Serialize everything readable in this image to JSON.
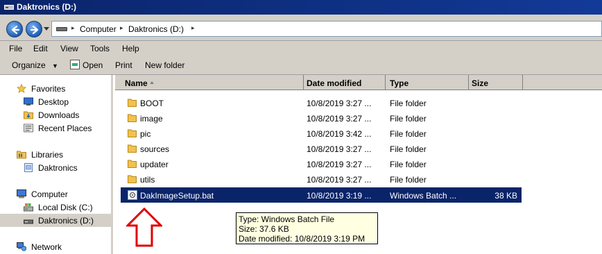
{
  "window": {
    "title": "Daktronics (D:)"
  },
  "address": {
    "crumbs": [
      "Computer",
      "Daktronics (D:)"
    ]
  },
  "menu": [
    "File",
    "Edit",
    "View",
    "Tools",
    "Help"
  ],
  "commands": {
    "organize": "Organize",
    "open": "Open",
    "print": "Print",
    "new_folder": "New folder"
  },
  "nav": {
    "favorites": "Favorites",
    "desktop": "Desktop",
    "downloads": "Downloads",
    "recent": "Recent Places",
    "libraries": "Libraries",
    "lib_daktronics": "Daktronics",
    "computer": "Computer",
    "local_disk": "Local Disk (C:)",
    "daktronics_drive": "Daktronics (D:)",
    "network": "Network"
  },
  "columns": {
    "name": "Name",
    "date": "Date modified",
    "type": "Type",
    "size": "Size"
  },
  "files": [
    {
      "name": "BOOT",
      "date": "10/8/2019 3:27 ...",
      "type": "File folder",
      "size": ""
    },
    {
      "name": "image",
      "date": "10/8/2019 3:27 ...",
      "type": "File folder",
      "size": ""
    },
    {
      "name": "pic",
      "date": "10/8/2019 3:42 ...",
      "type": "File folder",
      "size": ""
    },
    {
      "name": "sources",
      "date": "10/8/2019 3:27 ...",
      "type": "File folder",
      "size": ""
    },
    {
      "name": "updater",
      "date": "10/8/2019 3:27 ...",
      "type": "File folder",
      "size": ""
    },
    {
      "name": "utils",
      "date": "10/8/2019 3:27 ...",
      "type": "File folder",
      "size": ""
    },
    {
      "name": "DakImageSetup.bat",
      "date": "10/8/2019 3:19 ...",
      "type": "Windows Batch ...",
      "size": "38 KB"
    }
  ],
  "tooltip": {
    "type": "Type: Windows Batch File",
    "size": "Size: 37.6 KB",
    "date": "Date modified: 10/8/2019 3:19 PM"
  },
  "colors": {
    "selection": "#0a246a",
    "chrome": "#d4d0c8",
    "folder": "#f2c14e",
    "annotation": "#e00000"
  }
}
